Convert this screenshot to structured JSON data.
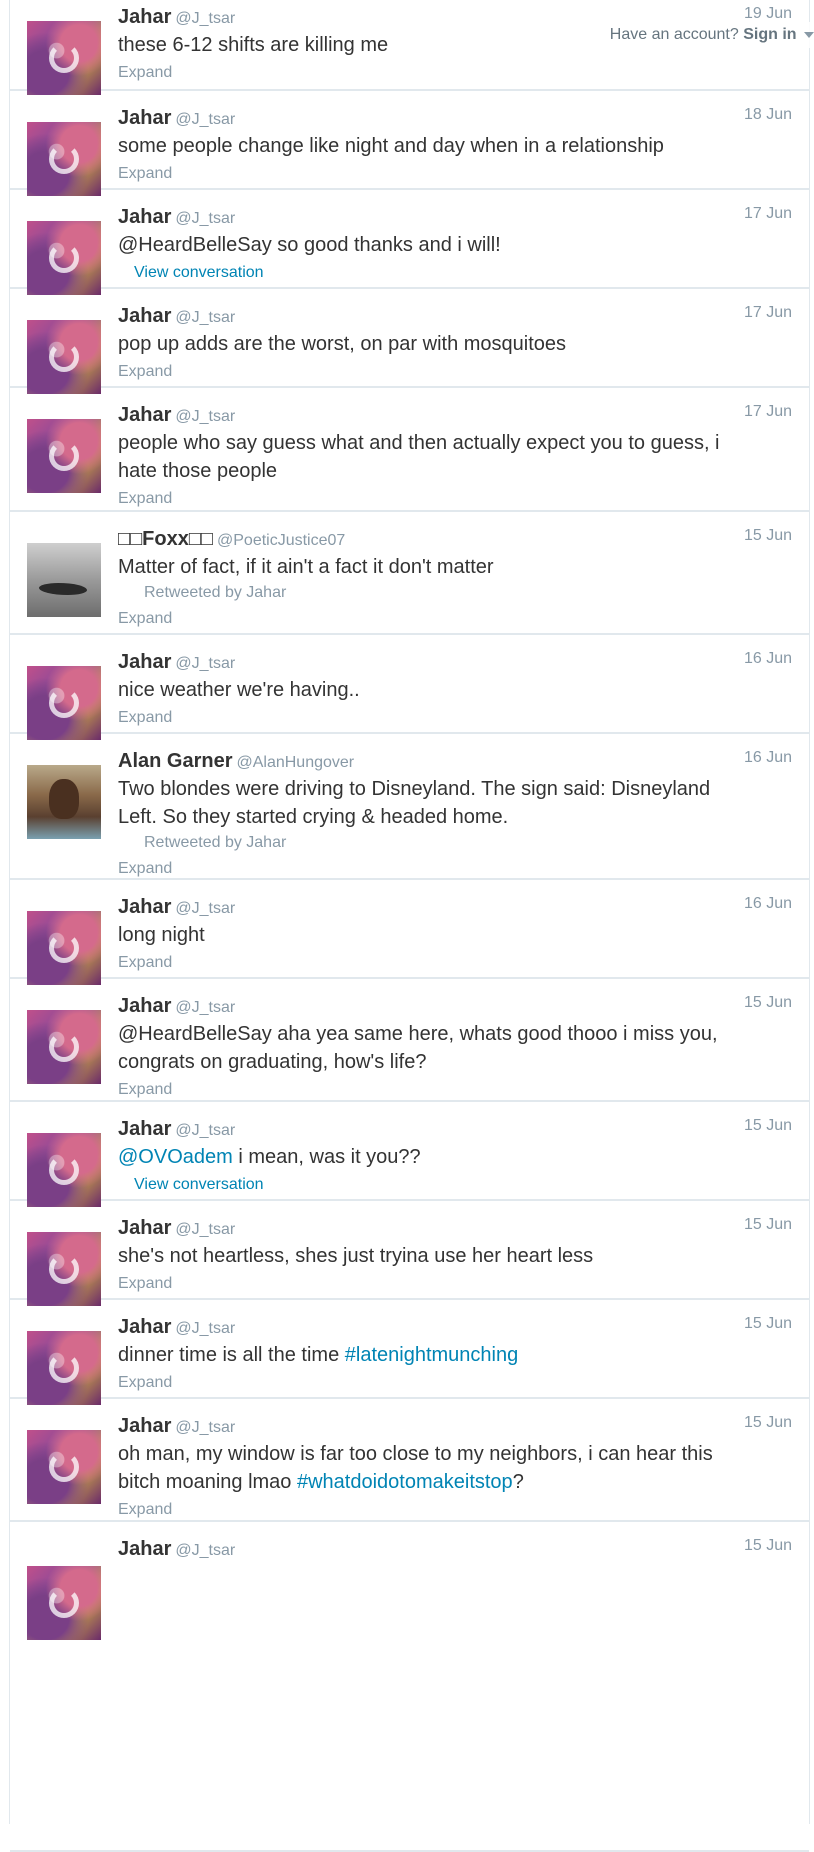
{
  "topbar": {
    "prompt": "Have an account?",
    "signin": "Sign in"
  },
  "tweets": [
    {
      "name": "Jahar",
      "handle": "@J_tsar",
      "time": "19 Jun",
      "avatar": "jahar",
      "parts": [
        {
          "t": "these 6-12 shifts are killing me"
        }
      ],
      "footer": "Expand"
    },
    {
      "name": "Jahar",
      "handle": "@J_tsar",
      "time": "18 Jun",
      "avatar": "jahar",
      "parts": [
        {
          "t": "some people change like night and day when in a relationship"
        }
      ],
      "footer": "Expand"
    },
    {
      "name": "Jahar",
      "handle": "@J_tsar",
      "time": "17 Jun",
      "avatar": "jahar",
      "parts": [
        {
          "t": "@HeardBelleSay so good thanks and i will!"
        }
      ],
      "footer": "View conversation"
    },
    {
      "name": "Jahar",
      "handle": "@J_tsar",
      "time": "17 Jun",
      "avatar": "jahar",
      "parts": [
        {
          "t": "pop up adds are the worst, on par with mosquitoes"
        }
      ],
      "footer": "Expand"
    },
    {
      "name": "Jahar",
      "handle": "@J_tsar",
      "time": "17 Jun",
      "avatar": "jahar",
      "parts": [
        {
          "t": "people who say guess what and then actually expect you to guess, i hate those people"
        }
      ],
      "footer": "Expand"
    },
    {
      "name": "□□Foxx□□",
      "handle": "@PoeticJustice07",
      "time": "15 Jun",
      "avatar": "foxx",
      "parts": [
        {
          "t": "Matter of fact, if it ain't a fact it don't matter"
        }
      ],
      "retweeted": "Retweeted by Jahar",
      "footer": "Expand"
    },
    {
      "name": "Jahar",
      "handle": "@J_tsar",
      "time": "16 Jun",
      "avatar": "jahar",
      "parts": [
        {
          "t": "nice weather we're having.."
        }
      ],
      "footer": "Expand"
    },
    {
      "name": "Alan Garner",
      "handle": "@AlanHungover",
      "time": "16 Jun",
      "avatar": "alan",
      "parts": [
        {
          "t": "Two blondes were driving to Disneyland. The sign said: Disneyland Left. So they started crying & headed home."
        }
      ],
      "retweeted": "Retweeted by Jahar",
      "footer": "Expand"
    },
    {
      "name": "Jahar",
      "handle": "@J_tsar",
      "time": "16 Jun",
      "avatar": "jahar",
      "parts": [
        {
          "t": "long night"
        }
      ],
      "footer": "Expand"
    },
    {
      "name": "Jahar",
      "handle": "@J_tsar",
      "time": "15 Jun",
      "avatar": "jahar",
      "parts": [
        {
          "t": "@HeardBelleSay aha yea same here, whats good thooo i miss you, congrats on graduating, how's life?"
        }
      ],
      "footer": "Expand"
    },
    {
      "name": "Jahar",
      "handle": "@J_tsar",
      "time": "15 Jun",
      "avatar": "jahar",
      "parts": [
        {
          "t": "@OVOadem",
          "link": true
        },
        {
          "t": " i mean, was it you??"
        }
      ],
      "footer": "View conversation"
    },
    {
      "name": "Jahar",
      "handle": "@J_tsar",
      "time": "15 Jun",
      "avatar": "jahar",
      "parts": [
        {
          "t": "she's not heartless, shes just tryina use her heart less"
        }
      ],
      "footer": "Expand"
    },
    {
      "name": "Jahar",
      "handle": "@J_tsar",
      "time": "15 Jun",
      "avatar": "jahar",
      "parts": [
        {
          "t": "dinner time is all the time "
        },
        {
          "t": "#latenightmunching",
          "link": true
        }
      ],
      "footer": "Expand"
    },
    {
      "name": "Jahar",
      "handle": "@J_tsar",
      "time": "15 Jun",
      "avatar": "jahar",
      "parts": [
        {
          "t": "oh man, my window is far too close to my neighbors, i can hear this bitch moaning lmao "
        },
        {
          "t": "#whatdoidotomakeitstop",
          "link": true
        },
        {
          "t": "?"
        }
      ],
      "footer": "Expand"
    },
    {
      "name": "Jahar",
      "handle": "@J_tsar",
      "time": "15 Jun",
      "avatar": "jahar",
      "parts": [],
      "footer": ""
    }
  ]
}
